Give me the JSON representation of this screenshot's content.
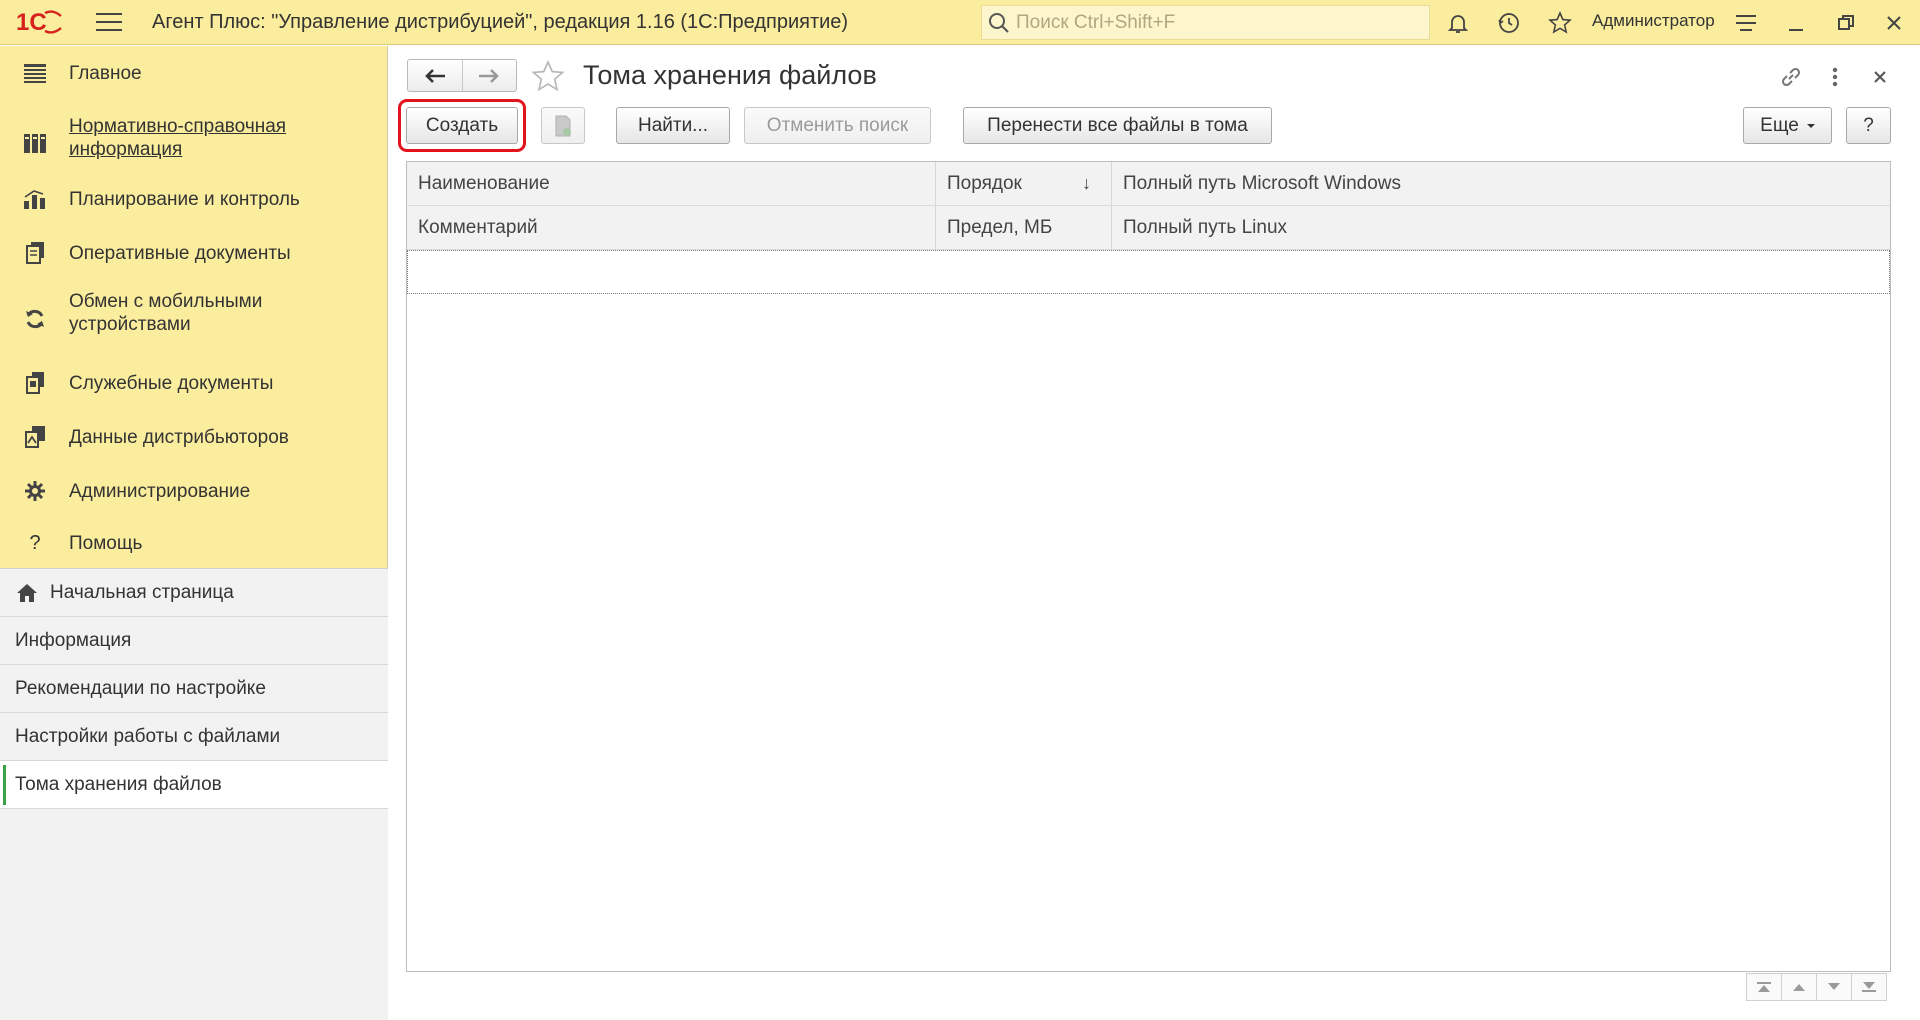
{
  "titlebar": {
    "logo_text": "1С",
    "app_title": "Агент Плюс: \"Управление дистрибуцией\", редакция 1.16  (1С:Предприятие)",
    "search_placeholder": "Поиск Ctrl+Shift+F",
    "user_name": "Администратор",
    "icons": [
      "menu-icon",
      "bell-icon",
      "history-icon",
      "star-icon",
      "settings-icon",
      "minimize-icon",
      "restore-icon",
      "close-icon"
    ]
  },
  "sidebar": {
    "sections": [
      {
        "label": "Главное",
        "icon": "menu-lines-icon",
        "link": false
      },
      {
        "label": "Нормативно-справочная информация",
        "icon": "books-icon",
        "link": true
      },
      {
        "label": "Планирование и контроль",
        "icon": "bar-chart-icon",
        "link": false
      },
      {
        "label": "Оперативные документы",
        "icon": "documents-icon",
        "link": false
      },
      {
        "label": "Обмен с мобильными устройствами",
        "icon": "sync-icon",
        "link": false
      },
      {
        "label": "Служебные документы",
        "icon": "service-docs-icon",
        "link": false
      },
      {
        "label": "Данные дистрибьюторов",
        "icon": "distributor-data-icon",
        "link": false
      },
      {
        "label": "Администрирование",
        "icon": "gear-icon",
        "link": false
      },
      {
        "label": "Помощь",
        "icon": "help-icon",
        "link": false
      }
    ],
    "open_windows": [
      {
        "label": "Начальная страница",
        "icon": "home-icon"
      },
      {
        "label": "Информация"
      },
      {
        "label": "Рекомендации по настройке"
      },
      {
        "label": "Настройки работы с файлами"
      },
      {
        "label": "Тома хранения файлов",
        "active": true
      }
    ]
  },
  "form": {
    "title": "Тома хранения файлов",
    "toolbar": {
      "create": "Создать",
      "find": "Найти...",
      "cancel_search": "Отменить поиск",
      "move_files": "Перенести все файлы в тома",
      "more": "Еще",
      "help": "?"
    },
    "table": {
      "row1_headers": [
        "Наименование",
        "Порядок",
        "Полный путь Microsoft Windows"
      ],
      "row2_headers": [
        "Комментарий",
        "Предел, МБ",
        "Полный путь Linux"
      ],
      "sort_indicator": "↓",
      "rows": []
    }
  },
  "colors": {
    "sidebar_bg": "#fbed9e",
    "highlight": "#e2131d",
    "active_marker": "#3aa34a"
  }
}
